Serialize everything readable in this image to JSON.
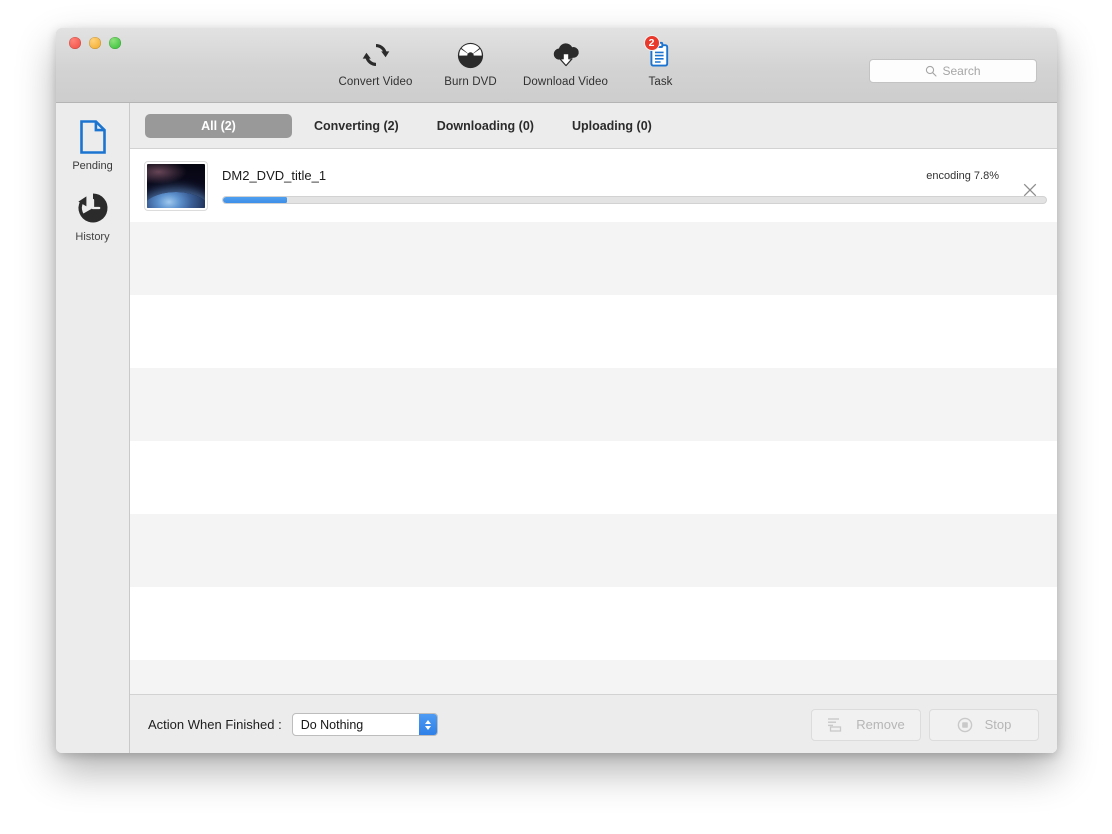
{
  "window": {
    "traffic_lights": [
      "close",
      "minimize",
      "maximize"
    ]
  },
  "toolbar": {
    "items": [
      {
        "label": "Convert Video",
        "icon": "convert-video-icon",
        "active": false
      },
      {
        "label": "Burn DVD",
        "icon": "burn-dvd-icon",
        "active": false
      },
      {
        "label": "Download Video",
        "icon": "download-video-icon",
        "active": false
      },
      {
        "label": "Task",
        "icon": "task-icon",
        "active": true,
        "badge": "2"
      }
    ],
    "search": {
      "placeholder": "Search",
      "value": "",
      "icon": "search-icon"
    }
  },
  "sidebar": {
    "items": [
      {
        "label": "Pending",
        "icon": "document-icon",
        "active": true
      },
      {
        "label": "History",
        "icon": "clock-history-icon",
        "active": false
      }
    ]
  },
  "tabs": [
    {
      "label": "All (2)",
      "active": true
    },
    {
      "label": "Converting (2)",
      "active": false
    },
    {
      "label": "Downloading (0)",
      "active": false
    },
    {
      "label": "Uploading (0)",
      "active": false
    }
  ],
  "tasks": [
    {
      "title": "DM2_DVD_title_1",
      "status": "encoding 7.8%",
      "progress_percent": 7.8,
      "thumbnail": "earth-from-space-thumbnail",
      "close_icon": "close-icon"
    }
  ],
  "empty_rows": 8,
  "footer": {
    "action_label": "Action When Finished :",
    "action_value": "Do Nothing",
    "action_options": [
      "Do Nothing"
    ],
    "buttons": [
      {
        "label": "Remove",
        "icon": "remove-list-icon",
        "disabled": true
      },
      {
        "label": "Stop",
        "icon": "stop-icon",
        "disabled": true
      }
    ]
  },
  "colors": {
    "accent_blue": "#3d8ee8",
    "badge_red": "#e8392c",
    "tab_active_bg": "#999999",
    "row_alt": "#f4f4f4"
  }
}
